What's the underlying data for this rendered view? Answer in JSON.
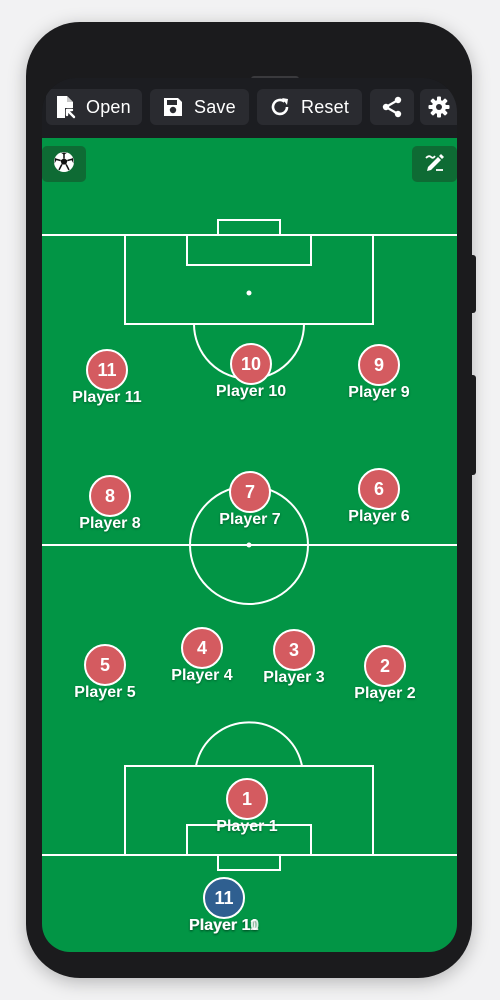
{
  "toolbar": {
    "open_label": "Open",
    "save_label": "Save",
    "reset_label": "Reset"
  },
  "icons": {
    "open": "file-open-icon",
    "save": "floppy-disk-icon",
    "reset": "refresh-icon",
    "share": "share-icon",
    "settings": "gear-icon",
    "ball": "soccer-ball-icon",
    "draw": "pencil-edit-icon"
  },
  "colors": {
    "pitch": "#029545",
    "player_token": "#d45b60",
    "bench_token": "#2f5f90",
    "toolbar": "#1c1d21"
  },
  "players": [
    {
      "number": "11",
      "name": "Player 11"
    },
    {
      "number": "10",
      "name": "Player 10"
    },
    {
      "number": "9",
      "name": "Player 9"
    },
    {
      "number": "8",
      "name": "Player 8"
    },
    {
      "number": "7",
      "name": "Player 7"
    },
    {
      "number": "6",
      "name": "Player 6"
    },
    {
      "number": "5",
      "name": "Player 5"
    },
    {
      "number": "4",
      "name": "Player 4"
    },
    {
      "number": "3",
      "name": "Player 3"
    },
    {
      "number": "2",
      "name": "Player 2"
    },
    {
      "number": "1",
      "name": "Player 1"
    }
  ],
  "bench": {
    "number": "11",
    "name_a": "Player 11",
    "name_b": "Player 10"
  }
}
